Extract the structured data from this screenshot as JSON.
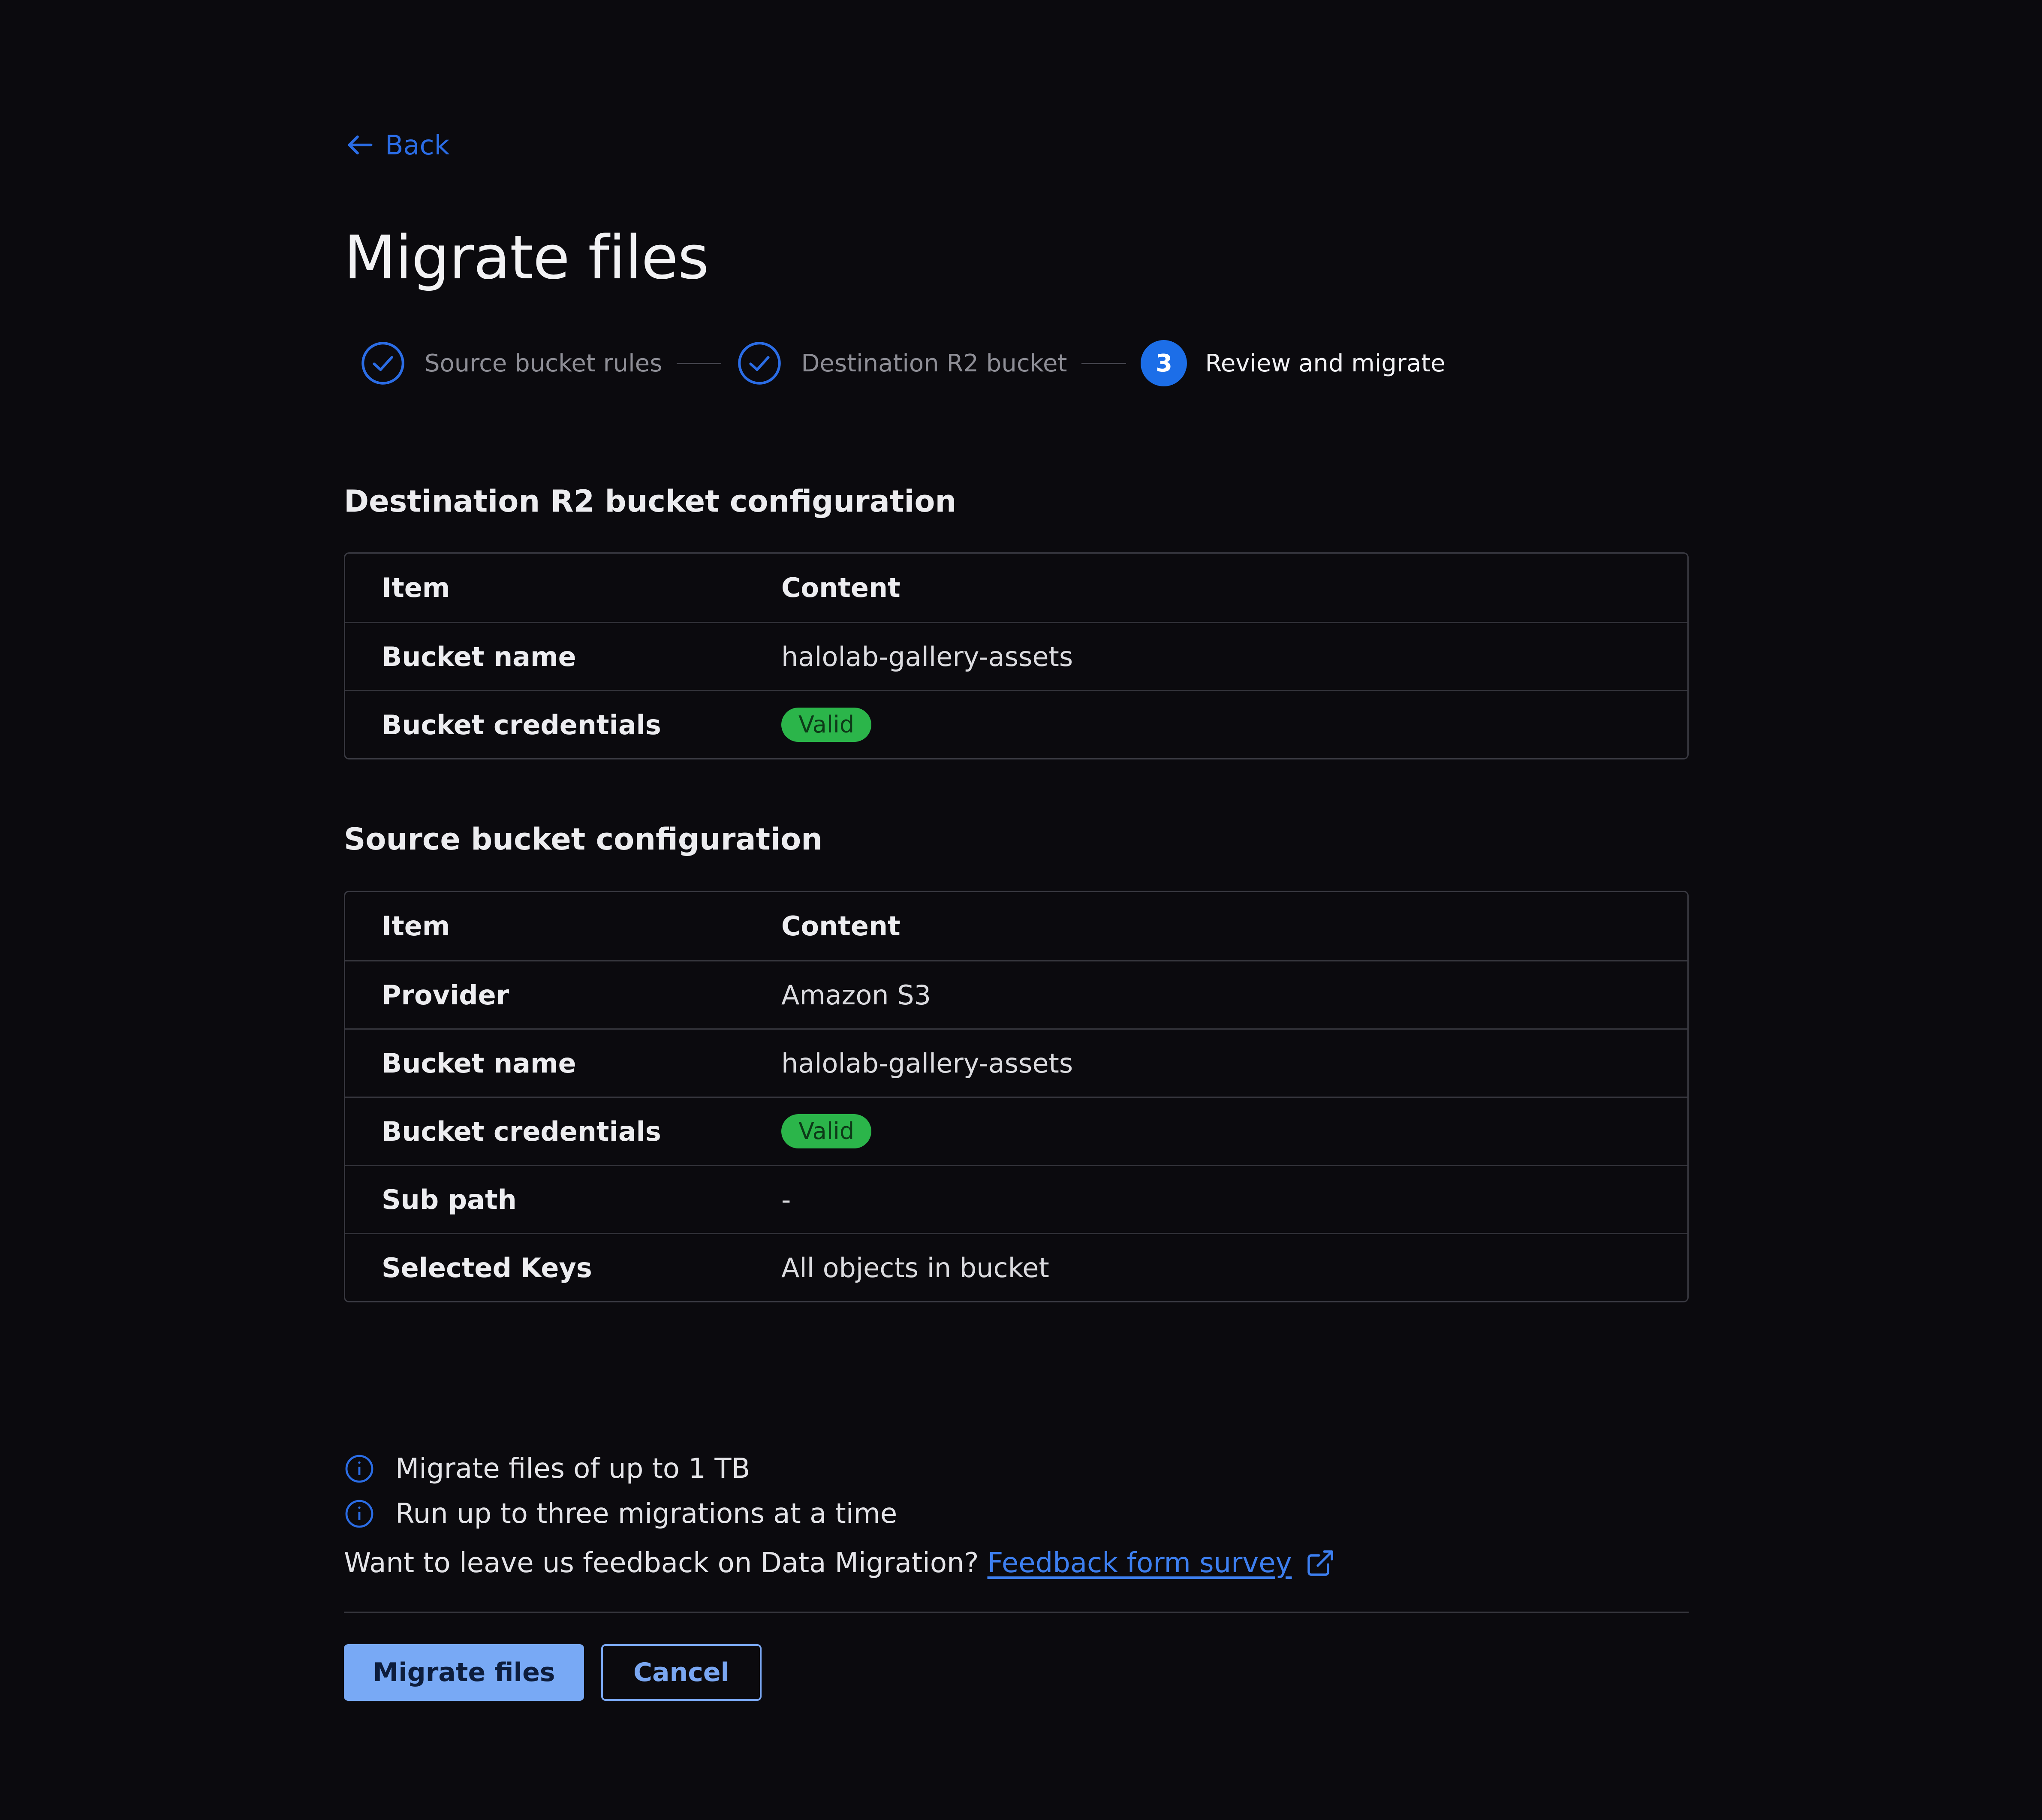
{
  "nav": {
    "back_label": "Back"
  },
  "page": {
    "title": "Migrate files"
  },
  "stepper": {
    "steps": [
      {
        "label": "Source bucket rules",
        "state": "complete"
      },
      {
        "label": "Destination R2 bucket",
        "state": "complete"
      },
      {
        "number": "3",
        "label": "Review and migrate",
        "state": "active"
      }
    ]
  },
  "destination": {
    "heading": "Destination R2 bucket configuration",
    "columns": [
      "Item",
      "Content"
    ],
    "rows": [
      {
        "item": "Bucket name",
        "content": "halolab-gallery-assets"
      },
      {
        "item": "Bucket credentials",
        "content": "Valid"
      }
    ]
  },
  "source": {
    "heading": "Source bucket configuration",
    "columns": [
      "Item",
      "Content"
    ],
    "rows": [
      {
        "item": "Provider",
        "content": "Amazon S3"
      },
      {
        "item": "Bucket name",
        "content": "halolab-gallery-assets"
      },
      {
        "item": "Bucket credentials",
        "content": "Valid"
      },
      {
        "item": "Sub path",
        "content": "-"
      },
      {
        "item": "Selected Keys",
        "content": "All objects in bucket"
      }
    ]
  },
  "info": {
    "lines": [
      "Migrate files of up to 1 TB",
      "Run up to three migrations at a time"
    ],
    "feedback_prompt": "Want to leave us feedback on Data Migration?",
    "feedback_link": "Feedback form survey"
  },
  "actions": {
    "primary": "Migrate files",
    "secondary": "Cancel"
  },
  "colors": {
    "background": "#0b0a0e",
    "accent": "#1c6ee8",
    "link": "#3d7ff0",
    "valid_badge": "#2bb54a",
    "primary_button": "#78a9f5"
  },
  "icons": {
    "back": "arrow-left-icon",
    "step_complete": "check-circle-icon",
    "info": "info-circle-icon",
    "external": "external-link-icon"
  }
}
